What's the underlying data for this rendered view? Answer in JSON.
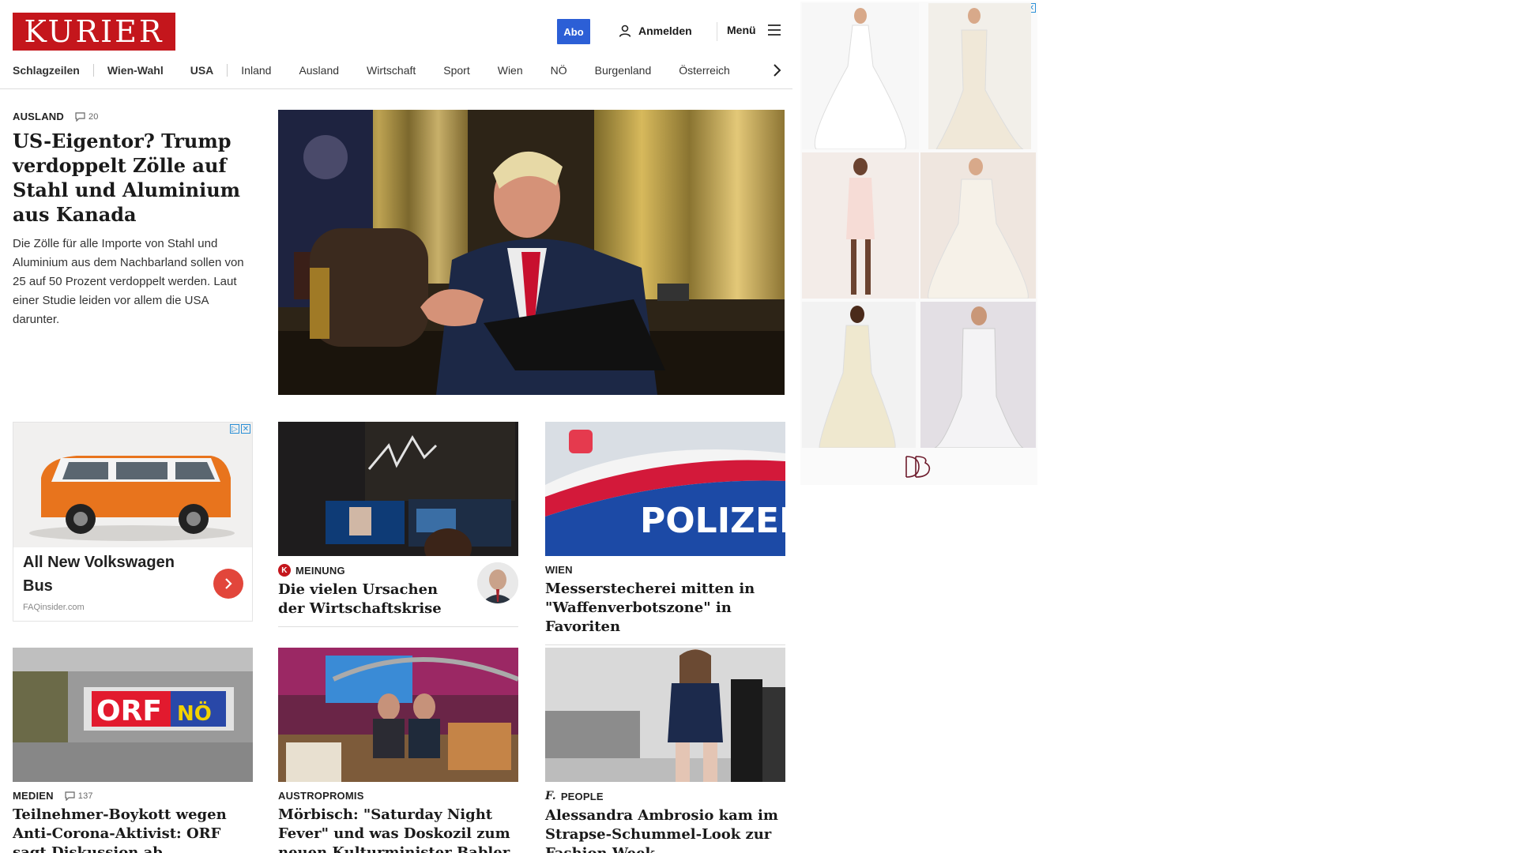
{
  "header": {
    "logo": "KURIER",
    "abo_label": "Abo",
    "login_label": "Anmelden",
    "menu_label": "Menü"
  },
  "nav": {
    "items": [
      "Schlagzeilen",
      "Wien-Wahl",
      "USA",
      "Inland",
      "Ausland",
      "Wirtschaft",
      "Sport",
      "Wien",
      "NÖ",
      "Burgenland",
      "Österreich"
    ],
    "icons": [
      "chevron-right-icon"
    ]
  },
  "lead": {
    "kicker": "AUSLAND",
    "comments": "20",
    "headline": "US-Eigentor? Trump verdoppelt Zölle auf Stahl und Aluminium aus Kanada",
    "teaser": "Die Zölle für alle Importe von Stahl und Aluminium aus dem Nachbarland sollen von 25 auf 50 Prozent verdoppelt werden. Laut einer Studie leiden vor allem die USA darunter."
  },
  "ad_vw": {
    "title": "All New Volkswagen Bus",
    "source": "FAQinsider.com"
  },
  "cards": [
    {
      "kicker": "MEINUNG",
      "headline": "Die vielen Ursachen der Wirtschaftskrise",
      "badge": "K"
    },
    {
      "kicker": "WIEN",
      "headline": "Messerstecherei mitten in \"Waffenverbotszone\" in Favoriten"
    },
    {
      "kicker": "MEDIEN",
      "comments": "137",
      "headline": "Teilnehmer-Boykott wegen Anti-Corona-Aktivist: ORF sagt Diskussion ab"
    },
    {
      "kicker": "AUSTROPROMIS",
      "headline": "Mörbisch: \"Saturday Night Fever\" und was Doskozil zum neuen Kulturminister Babler sagt"
    },
    {
      "kicker": "PEOPLE",
      "headline": "Alessandra Ambrosio kam im Strapse-Schummel-Look zur Fashion Week",
      "badge": "f."
    }
  ],
  "image_text": {
    "polizei": "POLIZEI",
    "orf": "ORF",
    "noe": "NÖ"
  },
  "colors": {
    "brand_red": "#c4161c",
    "abo_blue": "#2c5fd6",
    "ad_arrow": "#e2463b"
  }
}
